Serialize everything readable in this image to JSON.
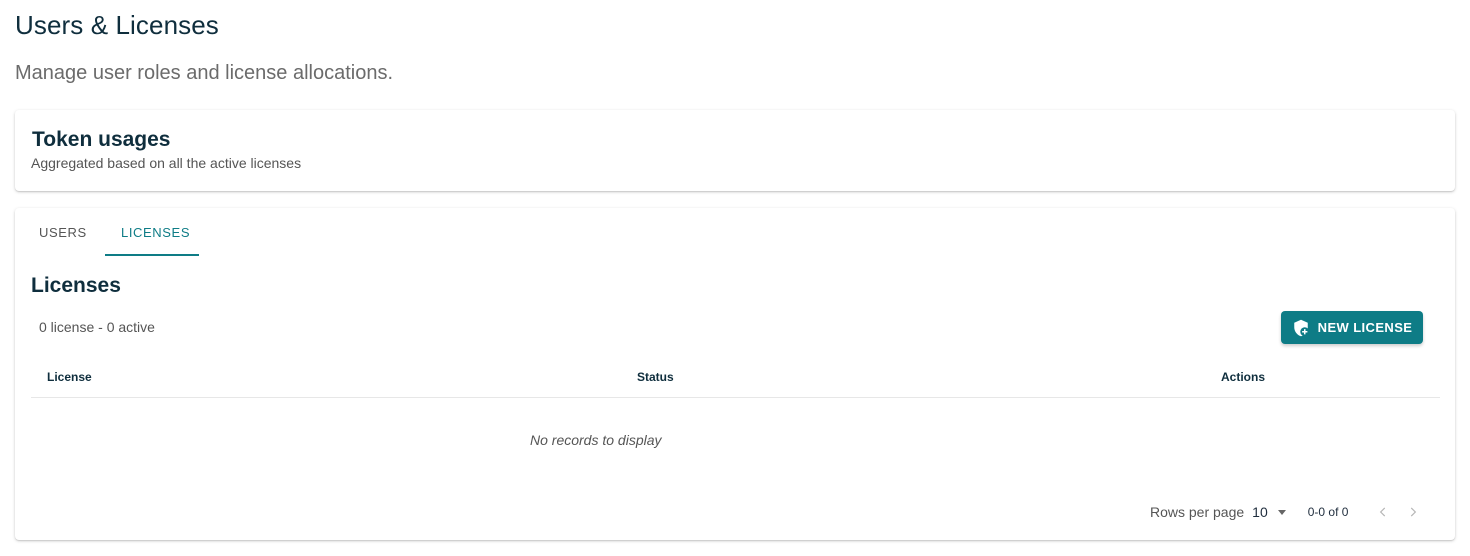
{
  "page": {
    "title": "Users & Licenses",
    "subtitle": "Manage user roles and license allocations."
  },
  "token_card": {
    "title": "Token usages",
    "subtitle": "Aggregated based on all the active licenses"
  },
  "tabs": [
    {
      "label": "USERS",
      "active": false
    },
    {
      "label": "LICENSES",
      "active": true
    }
  ],
  "licenses": {
    "title": "Licenses",
    "summary": "0 license - 0 active",
    "new_button_label": "NEW LICENSE",
    "new_button_icon": "shield-plus-icon",
    "columns": [
      "License",
      "Status",
      "Actions"
    ],
    "rows": [],
    "empty_message": "No records to display"
  },
  "pagination": {
    "rows_per_page_label": "Rows per page",
    "rows_per_page_value": "10",
    "range": "0-0 of 0",
    "prev_icon": "chevron-left-icon",
    "next_icon": "chevron-right-icon"
  },
  "colors": {
    "accent": "#0e7c86",
    "title": "#0f2e3d"
  }
}
